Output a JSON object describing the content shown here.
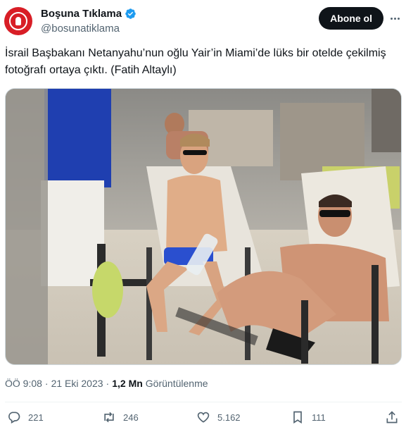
{
  "account": {
    "display_name": "Boşuna Tıklama",
    "handle": "@bosunatiklama",
    "follow_label": "Abone ol"
  },
  "tweet": {
    "text": "İsrail Başbakanı Netanyahu’nun oğlu Yair’in Miami’de lüks bir otelde çekilmiş fotoğrafı ortaya çıktı. (Fatih Altaylı)",
    "time": "ÖÖ 9:08",
    "separator": "·",
    "date": "21 Eki 2023",
    "views_count": "1,2 Mn",
    "views_label": "Görüntülenme"
  },
  "actions": {
    "replies": "221",
    "reposts": "246",
    "likes": "5.162",
    "bookmarks": "111"
  },
  "icons": {
    "verified": "verified-badge-icon",
    "reply": "reply-icon",
    "repost": "repost-icon",
    "like": "heart-icon",
    "bookmark": "bookmark-icon",
    "share": "share-icon"
  },
  "colors": {
    "accent": "#1d9bf0",
    "text": "#0f1419",
    "secondary": "#536471",
    "follow_bg": "#0f1419",
    "avatar_bg": "#d81e26"
  }
}
